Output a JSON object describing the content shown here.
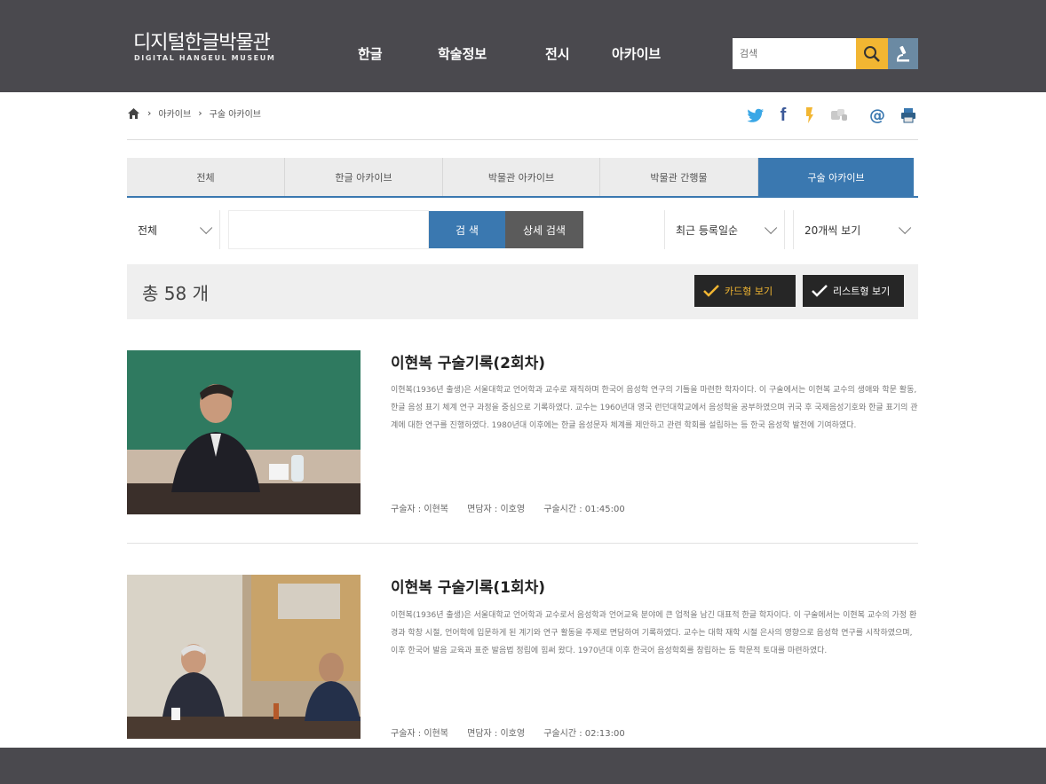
{
  "header": {
    "logo_ko": "디지털한글박물관",
    "logo_en": "DIGITAL HANGEUL MUSEUM",
    "nav": [
      "한글",
      "학술정보",
      "전시",
      "아카이브"
    ],
    "search_placeholder": "검색"
  },
  "breadcrumb": [
    "아카이브",
    "구술 아카이브"
  ],
  "tabs": [
    "전체",
    "한글 아카이브",
    "박물관 아카이브",
    "박물관 간행물",
    "구술 아카이브"
  ],
  "filters": {
    "category": "전체",
    "search_button": "검 색",
    "detail_button": "상세 검색",
    "sort": "최근 등록일순",
    "per_page": "20개씩 보기"
  },
  "count": {
    "label": "총 58 개"
  },
  "view_buttons": {
    "gallery": "카드형 보기",
    "list": "리스트형 보기"
  },
  "items": [
    {
      "title": "이현복 구술기록(2회차)",
      "desc": "이현복(1936년 출생)은 서울대학교 언어학과 교수로 재직하며 한국어 음성학 연구의 기틀을 마련한 학자이다. 이 구술에서는 이현복 교수의 생애와 학문 활동, 한글 음성 표기 체계 연구 과정을 중심으로 기록하였다. 교수는 1960년대 영국 런던대학교에서 음성학을 공부하였으며 귀국 후 국제음성기호와 한글 표기의 관계에 대한 연구를 진행하였다. 1980년대 이후에는 한글 음성문자 체계를 제안하고 관련 학회를 설립하는 등 한국 음성학 발전에 기여하였다.",
      "meta": {
        "speaker": "구술자 : 이현복",
        "interviewer": "면담자 : 이호영",
        "duration": "구술시간 : 01:45:00"
      }
    },
    {
      "title": "이현복 구술기록(1회차)",
      "desc": "이현복(1936년 출생)은 서울대학교 언어학과 교수로서 음성학과 언어교육 분야에 큰 업적을 남긴 대표적 한글 학자이다. 이 구술에서는 이현복 교수의 가정 환경과 학창 시절, 언어학에 입문하게 된 계기와 연구 활동을 주제로 면담하여 기록하였다. 교수는 대학 재학 시절 은사의 영향으로 음성학 연구를 시작하였으며, 이후 한국어 발음 교육과 표준 발음법 정립에 힘써 왔다. 1970년대 이후 한국어 음성학회를 창립하는 등 학문적 토대를 마련하였다.",
      "meta": {
        "speaker": "구술자 : 이현복",
        "interviewer": "면담자 : 이호영",
        "duration": "구술시간 : 02:13:00"
      }
    }
  ]
}
